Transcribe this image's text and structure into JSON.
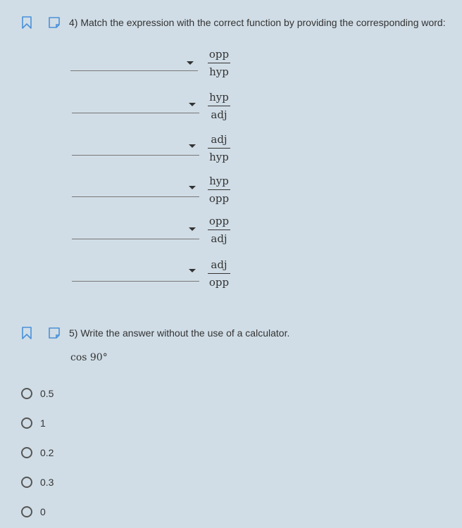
{
  "q4": {
    "text": "4) Match the expression with the correct function by providing the corresponding word:",
    "rows": [
      {
        "num": "opp",
        "den": "hyp"
      },
      {
        "num": "hyp",
        "den": "adj"
      },
      {
        "num": "adj",
        "den": "hyp"
      },
      {
        "num": "hyp",
        "den": "opp"
      },
      {
        "num": "opp",
        "den": "adj"
      },
      {
        "num": "adj",
        "den": "opp"
      }
    ]
  },
  "q5": {
    "text": "5) Write the answer without the use of a calculator.",
    "expression": "cos 90°",
    "options": [
      "0.5",
      "1",
      "0.2",
      "0.3",
      "0"
    ]
  },
  "icons": {
    "bookmark": "bookmark-icon",
    "note": "note-icon"
  },
  "colors": {
    "background": "#d0dde6",
    "accent": "#4a90d9"
  }
}
